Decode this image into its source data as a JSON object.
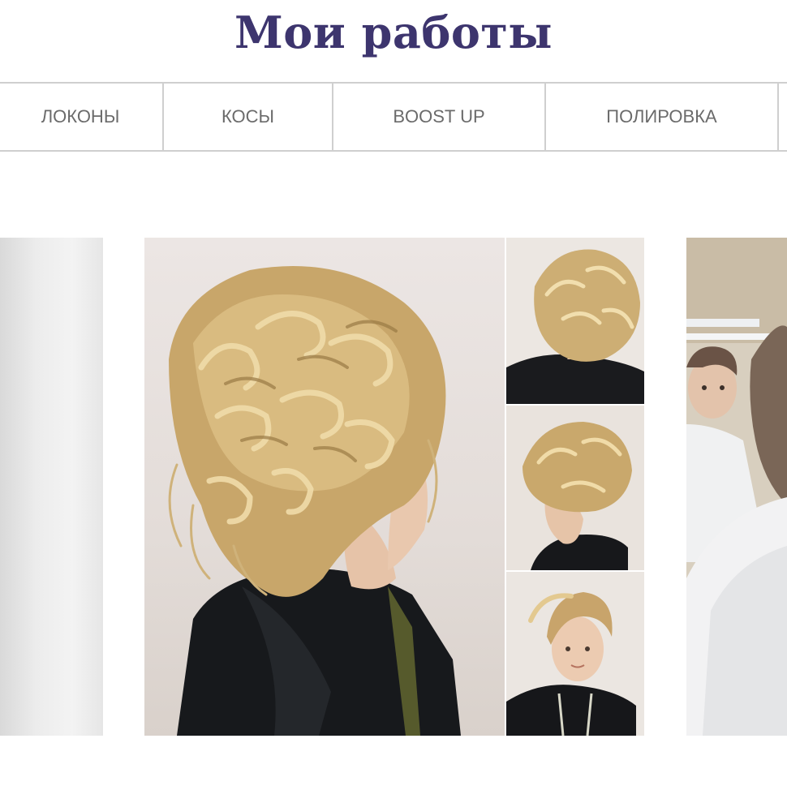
{
  "header": {
    "title": "Мои работы"
  },
  "filters": {
    "tabs": [
      {
        "label": "ЛОКОНЫ"
      },
      {
        "label": "КОСЫ"
      },
      {
        "label": "BOOST UP"
      },
      {
        "label": "ПОЛИРОВКА"
      },
      {
        "label": ""
      }
    ]
  },
  "gallery": {
    "items": [
      {
        "name": "gallery-photo-left"
      },
      {
        "name": "gallery-photo-center"
      },
      {
        "name": "gallery-photo-right"
      }
    ]
  },
  "colors": {
    "title": "#3d356e",
    "tab_text": "#6b6b6b",
    "tab_border": "#cfcfcf"
  }
}
